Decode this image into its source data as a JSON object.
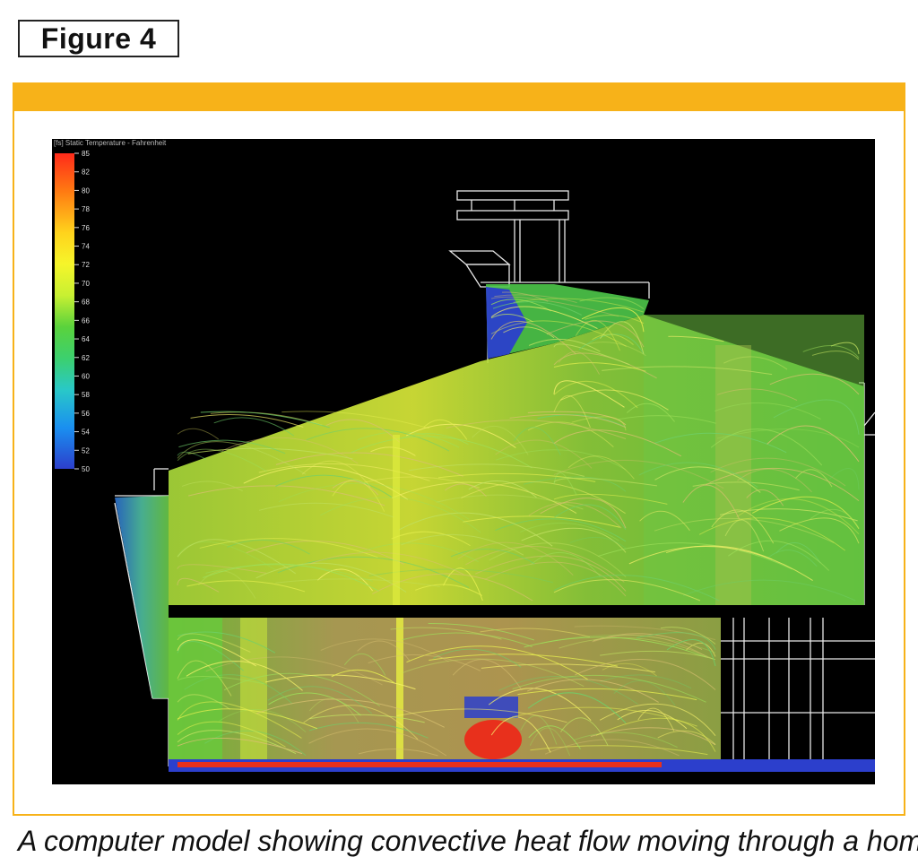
{
  "figure": {
    "label": "Figure 4",
    "accent_color": "#f7b219"
  },
  "simulation": {
    "legend_title": "[fs] Static Temperature - Fahrenheit",
    "scale_min": 50,
    "scale_max": 85,
    "scale_ticks": [
      "85",
      "82",
      "80",
      "78",
      "76",
      "74",
      "72",
      "70",
      "68",
      "66",
      "64",
      "62",
      "60",
      "58",
      "56",
      "54",
      "52",
      "50"
    ],
    "color_stops": [
      "#ff2a1a",
      "#ff7a12",
      "#ffd21c",
      "#f6f52a",
      "#c8f032",
      "#5ad23c",
      "#3cd06e",
      "#29c8c8",
      "#1a8ff0",
      "#2c3fcc"
    ]
  },
  "caption": {
    "text": "A computer model showing convective heat flow moving through a home"
  }
}
